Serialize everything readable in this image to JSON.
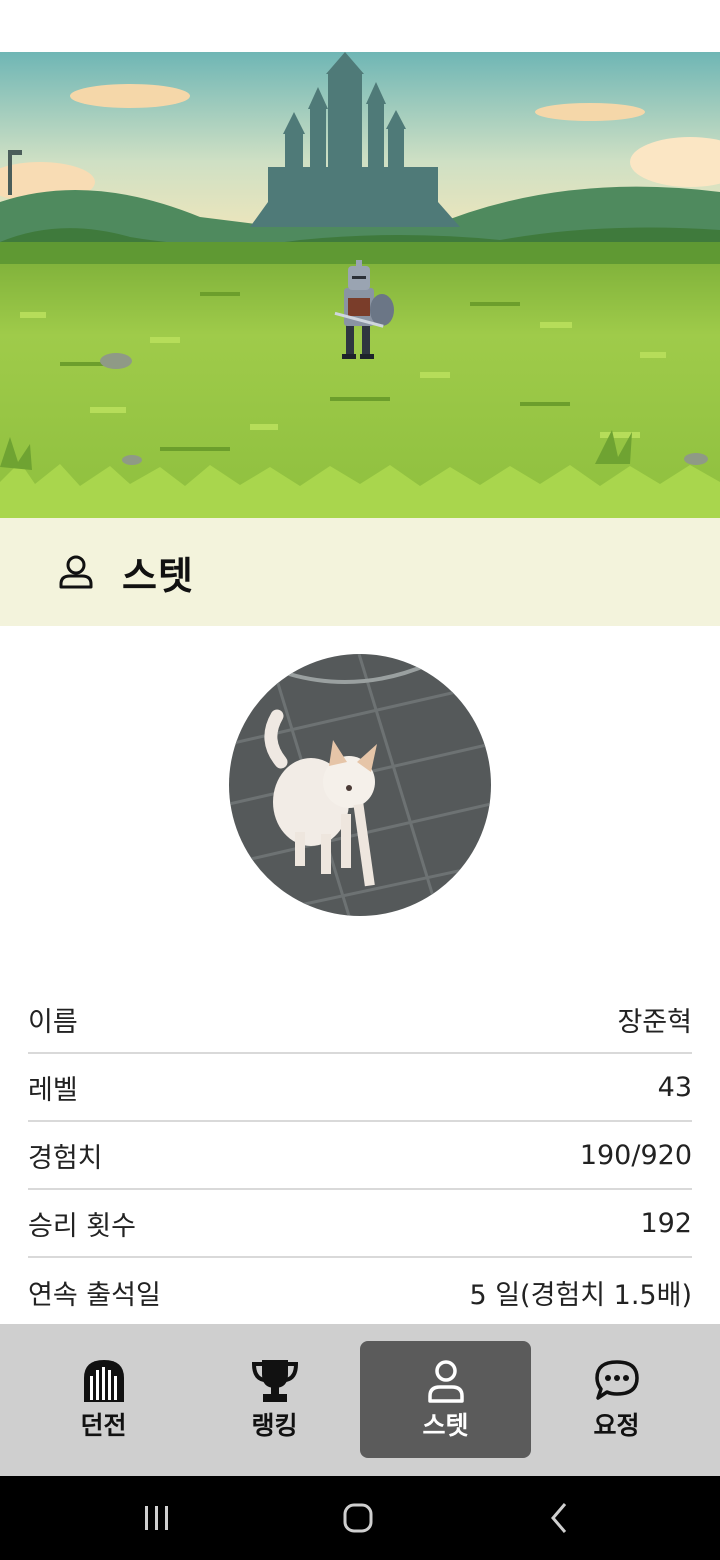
{
  "section": {
    "title": "스텟",
    "icon": "user-icon"
  },
  "stats": [
    {
      "label": "이름",
      "value": "장준혁"
    },
    {
      "label": "레벨",
      "value": "43"
    },
    {
      "label": "경험치",
      "value": "190/920"
    },
    {
      "label": "승리 횟수",
      "value": "192"
    },
    {
      "label": "연속 출석일",
      "value": "5 일(경험치 1.5배)"
    }
  ],
  "nav": [
    {
      "label": "던전",
      "icon": "gate-icon"
    },
    {
      "label": "랭킹",
      "icon": "trophy-icon"
    },
    {
      "label": "스텟",
      "icon": "user-icon",
      "active": true
    },
    {
      "label": "요정",
      "icon": "chat-bubble-icon"
    }
  ],
  "system_nav": [
    "recent-apps-icon",
    "home-icon",
    "back-icon"
  ],
  "colors": {
    "header_bg": "#f3f3dc",
    "nav_bg": "#cfcfcf",
    "nav_active": "#5b5b5b"
  }
}
